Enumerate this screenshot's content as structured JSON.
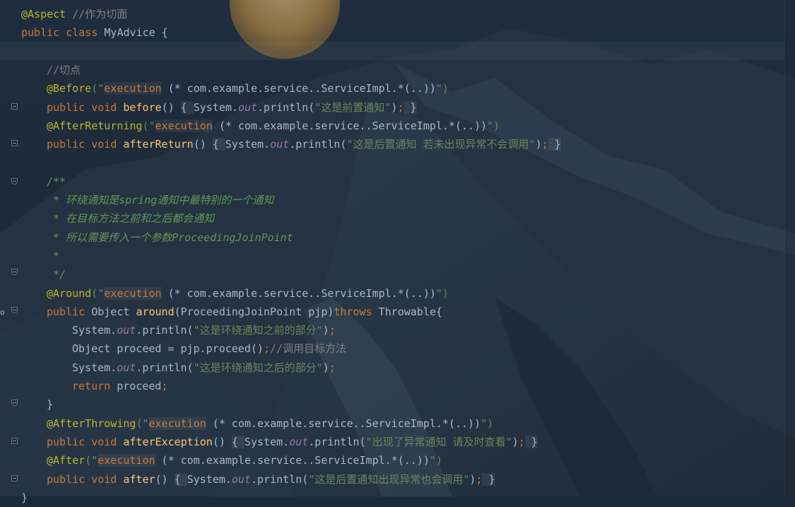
{
  "editor": {
    "lines": [
      {
        "indent": 0,
        "tokens": [
          {
            "t": "@Aspect",
            "c": "ann"
          },
          {
            "t": " //作为切面",
            "c": "cmt"
          }
        ]
      },
      {
        "indent": 0,
        "tokens": [
          {
            "t": "public ",
            "c": "kw"
          },
          {
            "t": "class ",
            "c": "kw"
          },
          {
            "t": "MyAdvice {",
            "c": ""
          }
        ]
      },
      {
        "indent": 0,
        "tokens": []
      },
      {
        "indent": 1,
        "tokens": [
          {
            "t": "//切点",
            "c": "cmt"
          }
        ]
      },
      {
        "indent": 1,
        "tokens": [
          {
            "t": "@Before",
            "c": "ann"
          },
          {
            "t": "(\"",
            "c": "str"
          },
          {
            "t": "execution",
            "c": "inj"
          },
          {
            "t": " (* com.example.service..ServiceImpl.*(..))",
            "c": ""
          },
          {
            "t": "\")",
            "c": "str"
          }
        ]
      },
      {
        "indent": 1,
        "tokens": [
          {
            "t": "public ",
            "c": "kw"
          },
          {
            "t": "void ",
            "c": "kw"
          },
          {
            "t": "before",
            "c": "fn"
          },
          {
            "t": "() ",
            "c": ""
          },
          {
            "t": "{ ",
            "c": "brace"
          },
          {
            "t": "System.",
            "c": ""
          },
          {
            "t": "out",
            "c": "fld"
          },
          {
            "t": ".println(",
            "c": ""
          },
          {
            "t": "\"这是前置通知\"",
            "c": "str"
          },
          {
            "t": ")",
            "c": ""
          },
          {
            "t": ";",
            "c": "semi"
          },
          {
            "t": " }",
            "c": "brace"
          }
        ]
      },
      {
        "indent": 1,
        "tokens": [
          {
            "t": "@AfterReturning",
            "c": "ann"
          },
          {
            "t": "(\"",
            "c": "str"
          },
          {
            "t": "execution",
            "c": "inj"
          },
          {
            "t": " (* com.example.service..ServiceImpl.*(..))",
            "c": ""
          },
          {
            "t": "\")",
            "c": "str"
          }
        ]
      },
      {
        "indent": 1,
        "tokens": [
          {
            "t": "public ",
            "c": "kw"
          },
          {
            "t": "void ",
            "c": "kw"
          },
          {
            "t": "afterReturn",
            "c": "fn"
          },
          {
            "t": "() ",
            "c": ""
          },
          {
            "t": "{ ",
            "c": "brace"
          },
          {
            "t": "System.",
            "c": ""
          },
          {
            "t": "out",
            "c": "fld"
          },
          {
            "t": ".println(",
            "c": ""
          },
          {
            "t": "\"这是后置通知 若未出现异常不会调用\"",
            "c": "str"
          },
          {
            "t": ")",
            "c": ""
          },
          {
            "t": ";",
            "c": "semi"
          },
          {
            "t": " }",
            "c": "brace"
          }
        ]
      },
      {
        "indent": 0,
        "tokens": []
      },
      {
        "indent": 1,
        "tokens": [
          {
            "t": "/**",
            "c": "doc"
          }
        ]
      },
      {
        "indent": 1,
        "tokens": [
          {
            "t": " * 环绕通知是spring通知中最特别的一个通知",
            "c": "doc"
          }
        ]
      },
      {
        "indent": 1,
        "tokens": [
          {
            "t": " * 在目标方法之前和之后都会通知",
            "c": "doc"
          }
        ]
      },
      {
        "indent": 1,
        "tokens": [
          {
            "t": " * 所以需要传入一个参数ProceedingJoinPoint",
            "c": "doc"
          }
        ]
      },
      {
        "indent": 1,
        "tokens": [
          {
            "t": " *",
            "c": "doc"
          }
        ]
      },
      {
        "indent": 1,
        "tokens": [
          {
            "t": " */",
            "c": "doc"
          }
        ]
      },
      {
        "indent": 1,
        "tokens": [
          {
            "t": "@Around",
            "c": "ann"
          },
          {
            "t": "(\"",
            "c": "str"
          },
          {
            "t": "execution",
            "c": "inj"
          },
          {
            "t": " (* com.example.service..ServiceImpl.*(..))",
            "c": ""
          },
          {
            "t": "\")",
            "c": "str"
          }
        ]
      },
      {
        "indent": 1,
        "tokens": [
          {
            "t": "public ",
            "c": "kw"
          },
          {
            "t": "Object ",
            "c": ""
          },
          {
            "t": "around",
            "c": "fn"
          },
          {
            "t": "(ProceedingJoinPoint pjp)",
            "c": ""
          },
          {
            "t": "throws ",
            "c": "kw"
          },
          {
            "t": "Throwable{",
            "c": ""
          }
        ]
      },
      {
        "indent": 2,
        "tokens": [
          {
            "t": "System.",
            "c": ""
          },
          {
            "t": "out",
            "c": "fld"
          },
          {
            "t": ".println(",
            "c": ""
          },
          {
            "t": "\"这是环绕通知之前的部分\"",
            "c": "str"
          },
          {
            "t": ")",
            "c": ""
          },
          {
            "t": ";",
            "c": "semi"
          }
        ]
      },
      {
        "indent": 2,
        "tokens": [
          {
            "t": "Object proceed = pjp.proceed()",
            "c": ""
          },
          {
            "t": ";",
            "c": "semi"
          },
          {
            "t": "//调用目标方法",
            "c": "cmt"
          }
        ]
      },
      {
        "indent": 2,
        "tokens": [
          {
            "t": "System.",
            "c": ""
          },
          {
            "t": "out",
            "c": "fld"
          },
          {
            "t": ".println(",
            "c": ""
          },
          {
            "t": "\"这是环绕通知之后的部分\"",
            "c": "str"
          },
          {
            "t": ")",
            "c": ""
          },
          {
            "t": ";",
            "c": "semi"
          }
        ]
      },
      {
        "indent": 2,
        "tokens": [
          {
            "t": "return ",
            "c": "kw"
          },
          {
            "t": "proceed",
            "c": ""
          },
          {
            "t": ";",
            "c": "semi"
          }
        ]
      },
      {
        "indent": 1,
        "tokens": [
          {
            "t": "}",
            "c": ""
          }
        ]
      },
      {
        "indent": 1,
        "tokens": [
          {
            "t": "@AfterThrowing",
            "c": "ann"
          },
          {
            "t": "(\"",
            "c": "str"
          },
          {
            "t": "execution",
            "c": "inj"
          },
          {
            "t": " (* com.example.service..ServiceImpl.*(..))",
            "c": ""
          },
          {
            "t": "\")",
            "c": "str"
          }
        ]
      },
      {
        "indent": 1,
        "tokens": [
          {
            "t": "public ",
            "c": "kw"
          },
          {
            "t": "void ",
            "c": "kw"
          },
          {
            "t": "afterException",
            "c": "fn"
          },
          {
            "t": "() ",
            "c": ""
          },
          {
            "t": "{ ",
            "c": "brace"
          },
          {
            "t": "System.",
            "c": ""
          },
          {
            "t": "out",
            "c": "fld"
          },
          {
            "t": ".println(",
            "c": ""
          },
          {
            "t": "\"出现了异常通知 请及时查看\"",
            "c": "str"
          },
          {
            "t": ")",
            "c": ""
          },
          {
            "t": ";",
            "c": "semi"
          },
          {
            "t": " }",
            "c": "brace"
          }
        ]
      },
      {
        "indent": 1,
        "tokens": [
          {
            "t": "@After",
            "c": "ann"
          },
          {
            "t": "(\"",
            "c": "str"
          },
          {
            "t": "execution",
            "c": "inj"
          },
          {
            "t": " (* com.example.service..ServiceImpl.*(..))",
            "c": ""
          },
          {
            "t": "\")",
            "c": "str"
          }
        ]
      },
      {
        "indent": 1,
        "tokens": [
          {
            "t": "public ",
            "c": "kw"
          },
          {
            "t": "void ",
            "c": "kw"
          },
          {
            "t": "after",
            "c": "fn"
          },
          {
            "t": "() ",
            "c": ""
          },
          {
            "t": "{ ",
            "c": "brace"
          },
          {
            "t": "System.",
            "c": ""
          },
          {
            "t": "out",
            "c": "fld"
          },
          {
            "t": ".println(",
            "c": ""
          },
          {
            "t": "\"这是后置通知出现异常也会调用\"",
            "c": "str"
          },
          {
            "t": ")",
            "c": ""
          },
          {
            "t": ";",
            "c": "semi"
          },
          {
            "t": " }",
            "c": "brace"
          }
        ]
      },
      {
        "indent": 0,
        "tokens": [
          {
            "t": "}",
            "c": ""
          }
        ]
      }
    ]
  },
  "colors": {
    "keyword": "#cc7832",
    "annotation": "#bbb529",
    "string": "#6a8759",
    "comment": "#808080",
    "doc_comment": "#629755",
    "method": "#ffc66d",
    "field": "#9876aa",
    "text": "#a9b7c6"
  },
  "icons": [
    "fold-icon",
    "implemented-marker-icon"
  ]
}
